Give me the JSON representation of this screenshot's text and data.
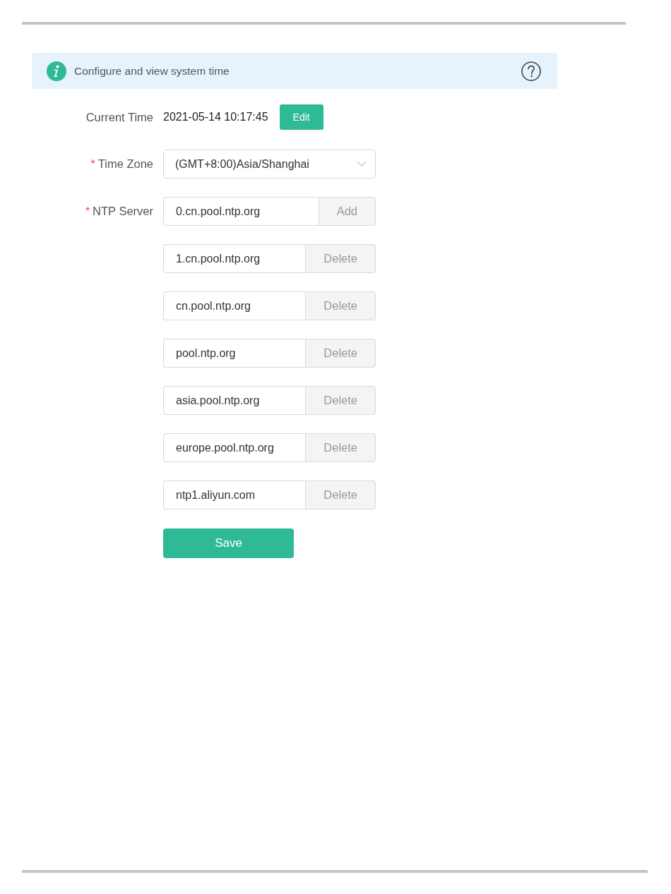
{
  "info_banner": {
    "text": "Configure and view system time"
  },
  "current_time": {
    "label": "Current Time",
    "value": "2021-05-14 10:17:45",
    "button": "Edit"
  },
  "time_zone": {
    "required_mark": "*",
    "label": "Time Zone",
    "value": "(GMT+8:00)Asia/Shanghai"
  },
  "ntp_server": {
    "required_mark": "*",
    "label": "NTP Server",
    "servers": [
      {
        "value": "0.cn.pool.ntp.org",
        "action": "Add"
      },
      {
        "value": "1.cn.pool.ntp.org",
        "action": "Delete"
      },
      {
        "value": "cn.pool.ntp.org",
        "action": "Delete"
      },
      {
        "value": "pool.ntp.org",
        "action": "Delete"
      },
      {
        "value": "asia.pool.ntp.org",
        "action": "Delete"
      },
      {
        "value": "europe.pool.ntp.org",
        "action": "Delete"
      },
      {
        "value": "ntp1.aliyun.com",
        "action": "Delete"
      }
    ]
  },
  "save_button": "Save"
}
